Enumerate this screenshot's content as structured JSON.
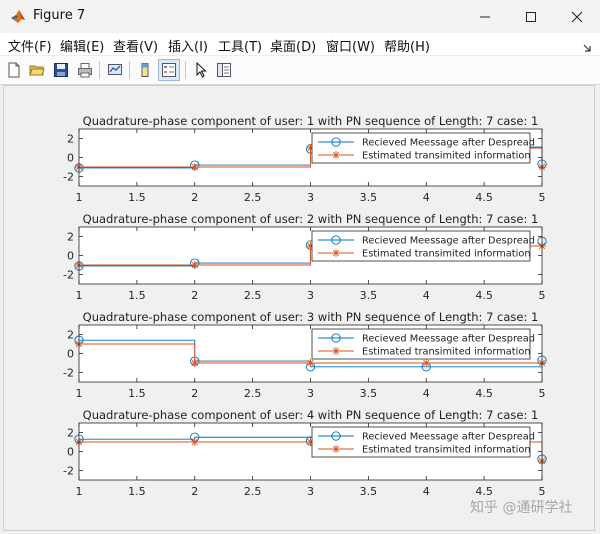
{
  "window": {
    "title": "Figure 7",
    "controls": [
      "minimize",
      "maximize",
      "close"
    ]
  },
  "menu": {
    "items": [
      {
        "label": "文件(F)"
      },
      {
        "label": "编辑(E)"
      },
      {
        "label": "查看(V)"
      },
      {
        "label": "插入(I)"
      },
      {
        "label": "工具(T)"
      },
      {
        "label": "桌面(D)"
      },
      {
        "label": "窗口(W)"
      },
      {
        "label": "帮助(H)"
      }
    ]
  },
  "toolbar": {
    "icons": [
      "new-figure-icon",
      "open-file-icon",
      "save-icon",
      "print-icon",
      "link-plot-icon",
      "colorbar-icon",
      "legend-icon",
      "pointer-icon",
      "property-inspector-icon"
    ]
  },
  "colors": {
    "series1": "#0072BD",
    "series2": "#D95319"
  },
  "watermark": "知乎 @通研学社",
  "chart_data": [
    {
      "type": "line",
      "title": "Quadrature-phase component of user: 1 with PN sequence of Length: 7 case: 1",
      "xlim": [
        1,
        5
      ],
      "ylim": [
        -3,
        3
      ],
      "xticks": [
        "1",
        "1.5",
        "2",
        "2.5",
        "3",
        "3.5",
        "4",
        "4.5",
        "5"
      ],
      "yticks": [
        "2",
        "0",
        "-2"
      ],
      "legend_position": "top-right",
      "x": [
        1,
        2,
        3,
        4,
        5
      ],
      "series": [
        {
          "name": "Recieved Meessage after Despread",
          "values": [
            -1.1,
            -0.8,
            0.9,
            1.1,
            -0.7
          ],
          "style": "stairs-circle"
        },
        {
          "name": "Estimated transimited information",
          "values": [
            -1,
            -1,
            1,
            1,
            -1
          ],
          "style": "stairs-star"
        }
      ]
    },
    {
      "type": "line",
      "title": "Quadrature-phase component of user: 2 with PN sequence of Length: 7 case: 1",
      "xlim": [
        1,
        5
      ],
      "ylim": [
        -3,
        3
      ],
      "xticks": [
        "1",
        "1.5",
        "2",
        "2.5",
        "3",
        "3.5",
        "4",
        "4.5",
        "5"
      ],
      "yticks": [
        "2",
        "0",
        "-2"
      ],
      "legend_position": "top-right",
      "x": [
        1,
        2,
        3,
        4,
        5
      ],
      "series": [
        {
          "name": "Recieved Meessage after Despread",
          "values": [
            -1.1,
            -0.8,
            1.1,
            1.0,
            1.5
          ],
          "style": "stairs-circle"
        },
        {
          "name": "Estimated transimited information",
          "values": [
            -1,
            -1,
            1,
            1,
            1
          ],
          "style": "stairs-star"
        }
      ]
    },
    {
      "type": "line",
      "title": "Quadrature-phase component of user: 3 with PN sequence of Length: 7 case: 1",
      "xlim": [
        1,
        5
      ],
      "ylim": [
        -3,
        3
      ],
      "xticks": [
        "1",
        "1.5",
        "2",
        "2.5",
        "3",
        "3.5",
        "4",
        "4.5",
        "5"
      ],
      "yticks": [
        "2",
        "0",
        "-2"
      ],
      "legend_position": "top-right",
      "x": [
        1,
        2,
        3,
        4,
        5
      ],
      "series": [
        {
          "name": "Recieved Meessage after Despread",
          "values": [
            1.4,
            -0.8,
            -1.4,
            -1.4,
            -0.7
          ],
          "style": "stairs-circle"
        },
        {
          "name": "Estimated transimited information",
          "values": [
            1,
            -1,
            -1,
            -1,
            -1
          ],
          "style": "stairs-star"
        }
      ]
    },
    {
      "type": "line",
      "title": "Quadrature-phase component of user: 4 with PN sequence of Length: 7 case: 1",
      "xlim": [
        1,
        5
      ],
      "ylim": [
        -3,
        3
      ],
      "xticks": [
        "1",
        "1.5",
        "2",
        "2.5",
        "3",
        "3.5",
        "4",
        "4.5",
        "5"
      ],
      "yticks": [
        "2",
        "0",
        "-2"
      ],
      "legend_position": "top-right",
      "x": [
        1,
        2,
        3,
        4,
        5
      ],
      "series": [
        {
          "name": "Recieved Meessage after Despread",
          "values": [
            1.3,
            1.5,
            1.1,
            1.0,
            -0.8
          ],
          "style": "stairs-circle"
        },
        {
          "name": "Estimated transimited information",
          "values": [
            1,
            1,
            1,
            1,
            -1
          ],
          "style": "stairs-star"
        }
      ]
    }
  ]
}
